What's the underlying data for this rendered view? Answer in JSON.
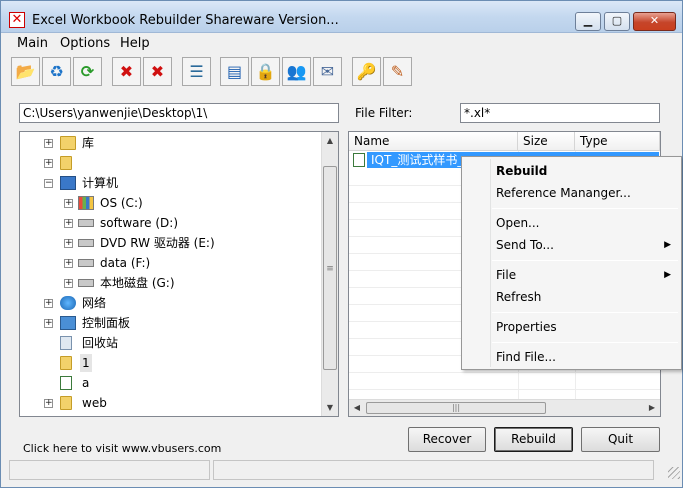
{
  "window": {
    "title": "Excel Workbook Rebuilder Shareware Version...",
    "app_icon_glyph": "✕"
  },
  "menu": [
    "Main",
    "Options",
    "Help"
  ],
  "toolbar": {
    "buttons": [
      {
        "name": "open-folder-icon",
        "glyph": "📂"
      },
      {
        "name": "refresh-globe-icon",
        "glyph": "♻"
      },
      {
        "name": "refresh-icon",
        "glyph": "⟳"
      },
      {
        "name": "delete-icon",
        "glyph": "✖"
      },
      {
        "name": "delete-all-icon",
        "glyph": "✖"
      },
      {
        "name": "tree-add-icon",
        "glyph": "☰"
      },
      {
        "name": "properties-icon",
        "glyph": "▤"
      },
      {
        "name": "lock-icon",
        "glyph": "🔒"
      },
      {
        "name": "users-icon",
        "glyph": "👥"
      },
      {
        "name": "mail-icon",
        "glyph": "✉"
      },
      {
        "name": "key-icon",
        "glyph": "🔑"
      },
      {
        "name": "edit-icon",
        "glyph": "✎"
      }
    ]
  },
  "path": {
    "value": "C:\\Users\\yanwenjie\\Desktop\\1\\"
  },
  "filter": {
    "label": "File Filter:",
    "value": "*.xl*"
  },
  "tree": {
    "items": [
      {
        "label": "库",
        "level": 1,
        "expander": "+",
        "icon": "folder"
      },
      {
        "label": "",
        "level": 1,
        "expander": "+",
        "icon": "folder"
      },
      {
        "label": "计算机",
        "level": 1,
        "expander": "−",
        "icon": "computer"
      },
      {
        "label": "OS (C:)",
        "level": 2,
        "expander": "+",
        "icon": "drive"
      },
      {
        "label": "software (D:)",
        "level": 2,
        "expander": "+",
        "icon": "drive"
      },
      {
        "label": "DVD RW 驱动器 (E:)",
        "level": 2,
        "expander": "+",
        "icon": "drive"
      },
      {
        "label": "data (F:)",
        "level": 2,
        "expander": "+",
        "icon": "drive"
      },
      {
        "label": "本地磁盘 (G:)",
        "level": 2,
        "expander": "+",
        "icon": "drive"
      },
      {
        "label": "网络",
        "level": 1,
        "expander": "+",
        "icon": "network"
      },
      {
        "label": "控制面板",
        "level": 1,
        "expander": "+",
        "icon": "control"
      },
      {
        "label": "回收站",
        "level": 1,
        "expander": "",
        "icon": "recycle"
      },
      {
        "label": "1",
        "level": 1,
        "expander": "",
        "icon": "folder"
      },
      {
        "label": "a",
        "level": 1,
        "expander": "",
        "icon": "file"
      },
      {
        "label": "web",
        "level": 1,
        "expander": "+",
        "icon": "folder"
      }
    ]
  },
  "list": {
    "columns": [
      "Name",
      "Size",
      "Type"
    ],
    "rows": [
      {
        "name": "IQT_测试式样书_"
      }
    ]
  },
  "context_menu": {
    "items": [
      {
        "label": "Rebuild",
        "bold": true,
        "submenu": false
      },
      {
        "label": "Reference Mananger...",
        "bold": false,
        "submenu": false
      },
      {
        "label": "Open...",
        "bold": false,
        "submenu": false
      },
      {
        "label": "Send To...",
        "bold": false,
        "submenu": true
      },
      {
        "label": "File",
        "bold": false,
        "submenu": true
      },
      {
        "label": "Refresh",
        "bold": false,
        "submenu": false
      },
      {
        "label": "Properties",
        "bold": false,
        "submenu": false
      },
      {
        "label": "Find File...",
        "bold": false,
        "submenu": false
      }
    ]
  },
  "footer": {
    "visit_link": "Click here to visit www.vbusers.com",
    "recover": "Recover",
    "rebuild": "Rebuild",
    "quit": "Quit"
  }
}
